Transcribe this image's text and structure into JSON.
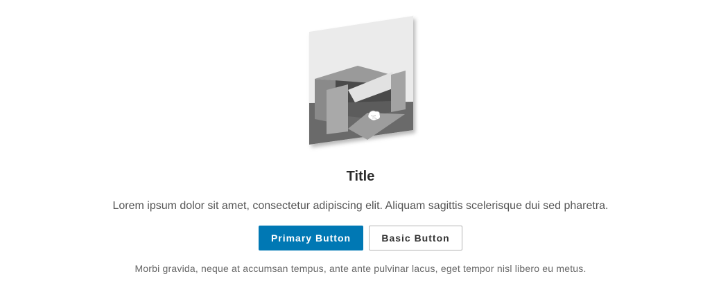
{
  "empty_state": {
    "illustration": "open-box-illustration",
    "title": "Title",
    "description": "Lorem ipsum dolor sit amet, consectetur adipiscing elit. Aliquam sagittis scelerisque dui sed pharetra.",
    "primary_button_label": "Primary Button",
    "basic_button_label": "Basic Button",
    "secondary_text": "Morbi gravida, neque at accumsan tempus, ante ante pulvinar lacus, eget tempor nisl libero eu metus."
  },
  "colors": {
    "primary": "#0078b4",
    "basic_border": "#b3b3b3",
    "title": "#2b2b2b",
    "body_text": "#555555"
  }
}
